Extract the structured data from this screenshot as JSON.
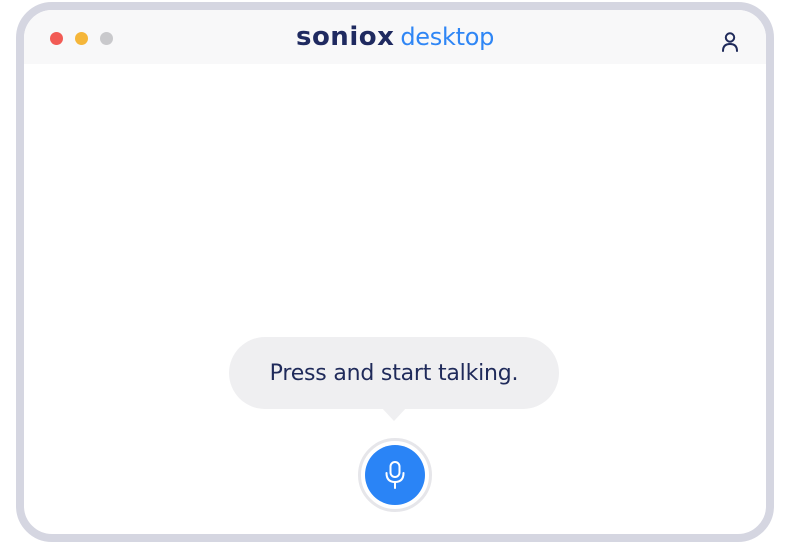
{
  "window": {
    "brand": {
      "name": "soniox",
      "product": "desktop",
      "name_color": "#1f2a60",
      "product_color": "#2f86f5"
    },
    "traffic_lights": {
      "close_color": "#f25b55",
      "minimize_color": "#f5b63a",
      "maximize_color": "#c9c9cc"
    },
    "account_icon": "user-icon"
  },
  "main": {
    "prompt_text": "Press and start talking.",
    "mic_icon": "microphone-icon",
    "accent_color": "#2a84f6"
  }
}
